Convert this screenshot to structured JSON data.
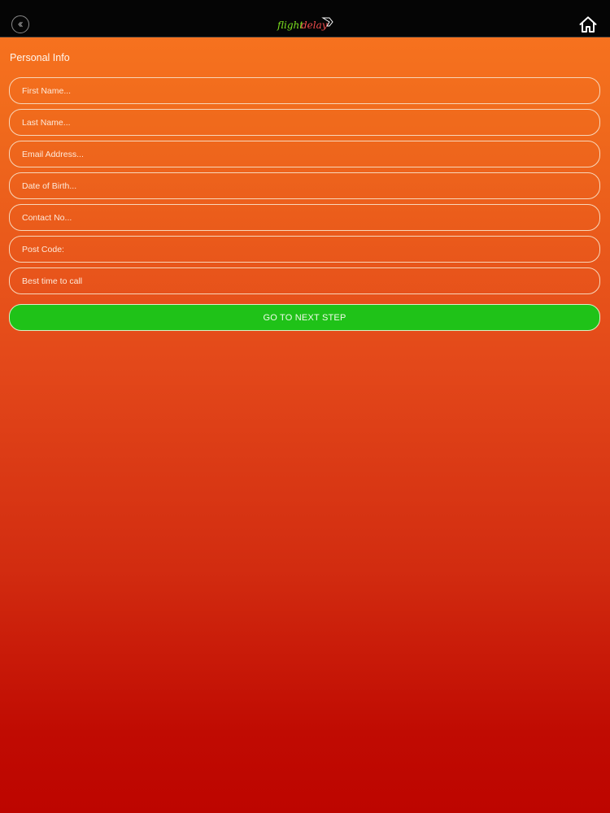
{
  "header": {
    "logo_text_primary": "flight",
    "logo_text_secondary": "delay",
    "back_icon": "chevron-left-circle-icon",
    "home_icon": "home-icon"
  },
  "form": {
    "title": "Personal Info",
    "fields": [
      {
        "placeholder": "First Name..."
      },
      {
        "placeholder": "Last Name..."
      },
      {
        "placeholder": "Email Address..."
      },
      {
        "placeholder": "Date of Birth..."
      },
      {
        "placeholder": "Contact No..."
      },
      {
        "placeholder": "Post Code:"
      },
      {
        "placeholder": "Best time to call"
      }
    ],
    "submit_label": "GO TO NEXT STEP"
  },
  "colors": {
    "accent_orange": "#f97520",
    "accent_red": "#bd0500",
    "button_green": "#1fc218",
    "topbar": "#050505"
  }
}
